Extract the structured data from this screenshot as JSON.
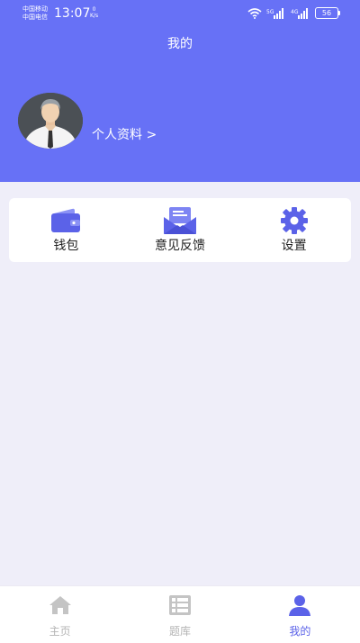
{
  "status_bar": {
    "carrier_1": "中国移动",
    "carrier_2": "中国电信",
    "time": "13:07",
    "speed_value": "0",
    "speed_unit": "K/s",
    "network_1": "5G",
    "network_2": "4G",
    "battery": "56"
  },
  "header": {
    "title": "我的",
    "profile_link": "个人资料 >"
  },
  "menu": {
    "items": [
      {
        "label": "钱包",
        "icon": "wallet-icon"
      },
      {
        "label": "意见反馈",
        "icon": "feedback-envelope-icon"
      },
      {
        "label": "设置",
        "icon": "gear-icon"
      }
    ]
  },
  "tabbar": {
    "tabs": [
      {
        "label": "主页",
        "icon": "home-icon",
        "active": false
      },
      {
        "label": "题库",
        "icon": "question-bank-icon",
        "active": false
      },
      {
        "label": "我的",
        "icon": "profile-icon",
        "active": true
      }
    ]
  },
  "colors": {
    "primary": "#6771f6",
    "icon_blue": "#5b62e8",
    "background": "#efeef9",
    "tab_inactive": "#b5b5b5"
  }
}
